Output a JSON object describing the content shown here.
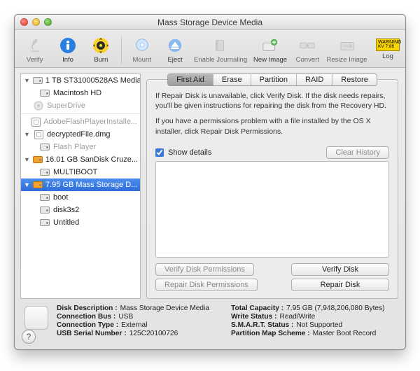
{
  "window": {
    "title": "Mass Storage Device Media"
  },
  "toolbar": {
    "verify": "Verify",
    "info": "Info",
    "burn": "Burn",
    "mount": "Mount",
    "eject": "Eject",
    "enable_journaling": "Enable Journaling",
    "new_image": "New Image",
    "convert": "Convert",
    "resize_image": "Resize Image",
    "log": "Log"
  },
  "sidebar": [
    {
      "label": "1 TB ST31000528AS Media",
      "children": [
        {
          "label": "Macintosh HD"
        }
      ]
    },
    {
      "label": "SuperDrive",
      "icon": "superdrive",
      "disabled": true
    },
    {
      "divider": true
    },
    {
      "label": "AdobeFlashPlayerInstalle...",
      "icon": "dmg",
      "disabled_text": true
    },
    {
      "label": "decryptedFile.dmg",
      "icon": "dmg",
      "children": [
        {
          "label": "Flash Player",
          "disabled_text": true
        }
      ]
    },
    {
      "label": "16.01 GB SanDisk Cruze...",
      "icon": "orange",
      "children": [
        {
          "label": "MULTIBOOT"
        }
      ]
    },
    {
      "label": "7.95 GB Mass Storage D...",
      "icon": "orange",
      "selected": true,
      "children": [
        {
          "label": "boot"
        },
        {
          "label": "disk3s2"
        },
        {
          "label": "Untitled"
        }
      ]
    }
  ],
  "tabs": {
    "items": [
      "First Aid",
      "Erase",
      "Partition",
      "RAID",
      "Restore"
    ],
    "active": 0
  },
  "help": {
    "p1": "If Repair Disk is unavailable, click Verify Disk. If the disk needs repairs, you'll be given instructions for repairing the disk from the Recovery HD.",
    "p2": "If you have a permissions problem with a file installed by the OS X installer, click Repair Disk Permissions."
  },
  "controls": {
    "show_details": "Show details",
    "clear_history": "Clear History",
    "verify_perms": "Verify Disk Permissions",
    "repair_perms": "Repair Disk Permissions",
    "verify_disk": "Verify Disk",
    "repair_disk": "Repair Disk"
  },
  "footer": {
    "left": [
      {
        "label": "Disk Description :",
        "value": "Mass Storage Device Media"
      },
      {
        "label": "Connection Bus :",
        "value": "USB"
      },
      {
        "label": "Connection Type :",
        "value": "External"
      },
      {
        "label": "USB Serial Number :",
        "value": "125C20100726"
      }
    ],
    "right": [
      {
        "label": "Total Capacity :",
        "value": "7.95 GB (7,948,206,080 Bytes)"
      },
      {
        "label": "Write Status :",
        "value": "Read/Write"
      },
      {
        "label": "S.M.A.R.T. Status :",
        "value": "Not Supported"
      },
      {
        "label": "Partition Map Scheme :",
        "value": "Master Boot Record"
      }
    ]
  }
}
